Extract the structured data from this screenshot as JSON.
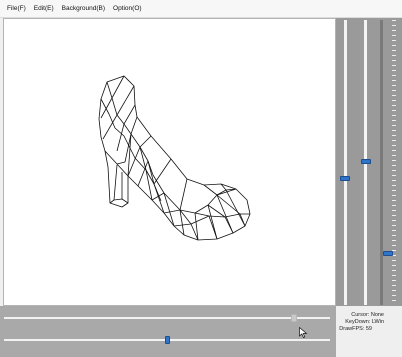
{
  "menu": {
    "file": "File(F)",
    "edit": "Edit(E)",
    "background": "Background(B)",
    "option": "Option(O)"
  },
  "viewport": {
    "model": "wireframe-high-heel-shoe",
    "background_color": "#ffffff",
    "line_color": "#111111"
  },
  "status": {
    "cursor_label": "Cursor:",
    "cursor_value": "None",
    "keydown_label": "KeyDown:",
    "keydown_value": "LWin",
    "drawfps_label": "DrawFPS:",
    "drawfps_value": "59"
  },
  "sliders": {
    "vertical": [
      {
        "name": "slider-1",
        "value": 0.57
      },
      {
        "name": "slider-2",
        "value": 0.51
      },
      {
        "name": "slider-3",
        "value": 0.83
      }
    ],
    "horizontal": [
      {
        "name": "slider-top",
        "value": 0.9,
        "enabled": false
      },
      {
        "name": "slider-bottom",
        "value": 0.5,
        "enabled": true
      }
    ]
  },
  "colors": {
    "accent": "#2f74c8",
    "panel": "#9a9a9a"
  }
}
